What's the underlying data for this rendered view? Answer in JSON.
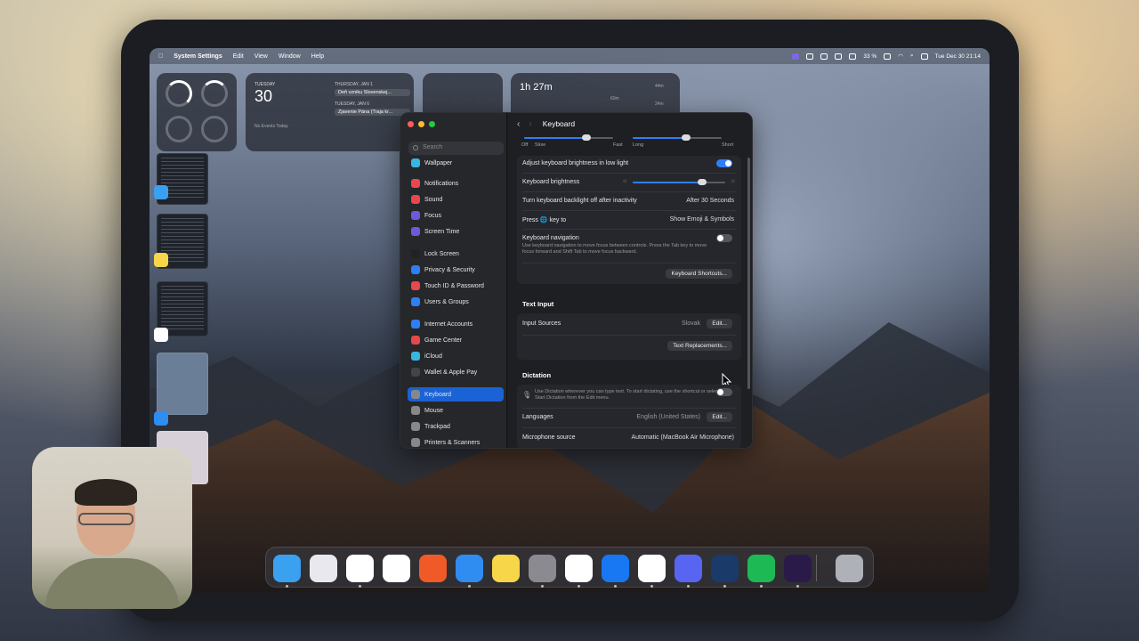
{
  "menubar": {
    "app": "System Settings",
    "menus": [
      "Edit",
      "View",
      "Window",
      "Help"
    ],
    "battery": "33 %",
    "datetime": "Tue Dec 30  21:14"
  },
  "calendar_widget": {
    "day_label": "TUESDAY",
    "day_num": "30",
    "no_events": "No Events Today",
    "e1_date": "THURSDAY, JAN 1",
    "e1_title": "Deň vzniku Slovenskej...",
    "e2_date": "TUESDAY, JAN 6",
    "e2_title": "Zjavenie Pána (Traja kr..."
  },
  "clock_widget": {
    "time": "21:14"
  },
  "timer_widget": {
    "title": "1h 27m",
    "m1": "44m",
    "m2": "60m",
    "m3": "24m"
  },
  "window": {
    "title": "Keyboard",
    "search_placeholder": "Search",
    "sidebar": [
      {
        "label": "Wallpaper",
        "color": "#38b6e0"
      },
      {
        "label": "Notifications",
        "color": "#e5484d"
      },
      {
        "label": "Sound",
        "color": "#e5484d"
      },
      {
        "label": "Focus",
        "color": "#6a5cd6"
      },
      {
        "label": "Screen Time",
        "color": "#6a5cd6"
      },
      {
        "label": "Lock Screen",
        "color": "#222222"
      },
      {
        "label": "Privacy & Security",
        "color": "#2f7ef5"
      },
      {
        "label": "Touch ID & Password",
        "color": "#e5484d"
      },
      {
        "label": "Users & Groups",
        "color": "#2f7ef5"
      },
      {
        "label": "Internet Accounts",
        "color": "#2f7ef5"
      },
      {
        "label": "Game Center",
        "color": "#e5484d"
      },
      {
        "label": "iCloud",
        "color": "#38b6e0"
      },
      {
        "label": "Wallet & Apple Pay",
        "color": "#444444"
      },
      {
        "label": "Keyboard",
        "color": "#888888"
      },
      {
        "label": "Mouse",
        "color": "#888888"
      },
      {
        "label": "Trackpad",
        "color": "#888888"
      },
      {
        "label": "Printers & Scanners",
        "color": "#888888"
      }
    ],
    "slider_labels": {
      "off": "Off",
      "slow": "Slow",
      "fast": "Fast",
      "long": "Long",
      "short": "Short"
    },
    "key_repeat_level": 0.7,
    "delay_level": 0.6,
    "brightness_level": 0.75,
    "rows": {
      "adjust_brightness": "Adjust keyboard brightness in low light",
      "kb_brightness": "Keyboard brightness",
      "backlight_off": "Turn keyboard backlight off after inactivity",
      "backlight_val": "After 30 Seconds",
      "press_key": "Press 🌐 key to",
      "press_key_val": "Show Emoji & Symbols",
      "kb_nav": "Keyboard navigation",
      "kb_nav_sub": "Use keyboard navigation to move focus between controls. Press the Tab key to move focus forward and Shift Tab to move focus backward.",
      "shortcuts_btn": "Keyboard Shortcuts...",
      "text_input_h": "Text Input",
      "input_sources": "Input Sources",
      "input_sources_val": "Slovak",
      "edit_btn": "Edit...",
      "text_repl_btn": "Text Replacements...",
      "dictation_h": "Dictation",
      "dictation_sub": "Use Dictation wherever you can type text. To start dictating, use the shortcut or select Start Dictation from the Edit menu.",
      "languages": "Languages",
      "languages_val": "English (United States)",
      "languages_edit": "Edit...",
      "mic_source": "Microphone source",
      "mic_source_val": "Automatic (MacBook Air Microphone)"
    }
  },
  "dock": [
    {
      "name": "finder",
      "color": "#3aa0f0"
    },
    {
      "name": "launchpad",
      "color": "#e8e8ee"
    },
    {
      "name": "chatgpt",
      "color": "#ffffff"
    },
    {
      "name": "capcut",
      "color": "#ffffff"
    },
    {
      "name": "brave",
      "color": "#f05a28"
    },
    {
      "name": "safari",
      "color": "#2f8cf0"
    },
    {
      "name": "notes",
      "color": "#f7d64a"
    },
    {
      "name": "system-settings",
      "color": "#8a8a90"
    },
    {
      "name": "chrome",
      "color": "#ffffff"
    },
    {
      "name": "facebook",
      "color": "#1877f2"
    },
    {
      "name": "gmail",
      "color": "#ffffff"
    },
    {
      "name": "discord",
      "color": "#5865f2"
    },
    {
      "name": "telegram-like",
      "color": "#1a3a6a"
    },
    {
      "name": "spotify",
      "color": "#1db954"
    },
    {
      "name": "arc-like",
      "color": "#2a1a4a"
    },
    {
      "name": "trash",
      "color": "#aeb2b8"
    }
  ]
}
